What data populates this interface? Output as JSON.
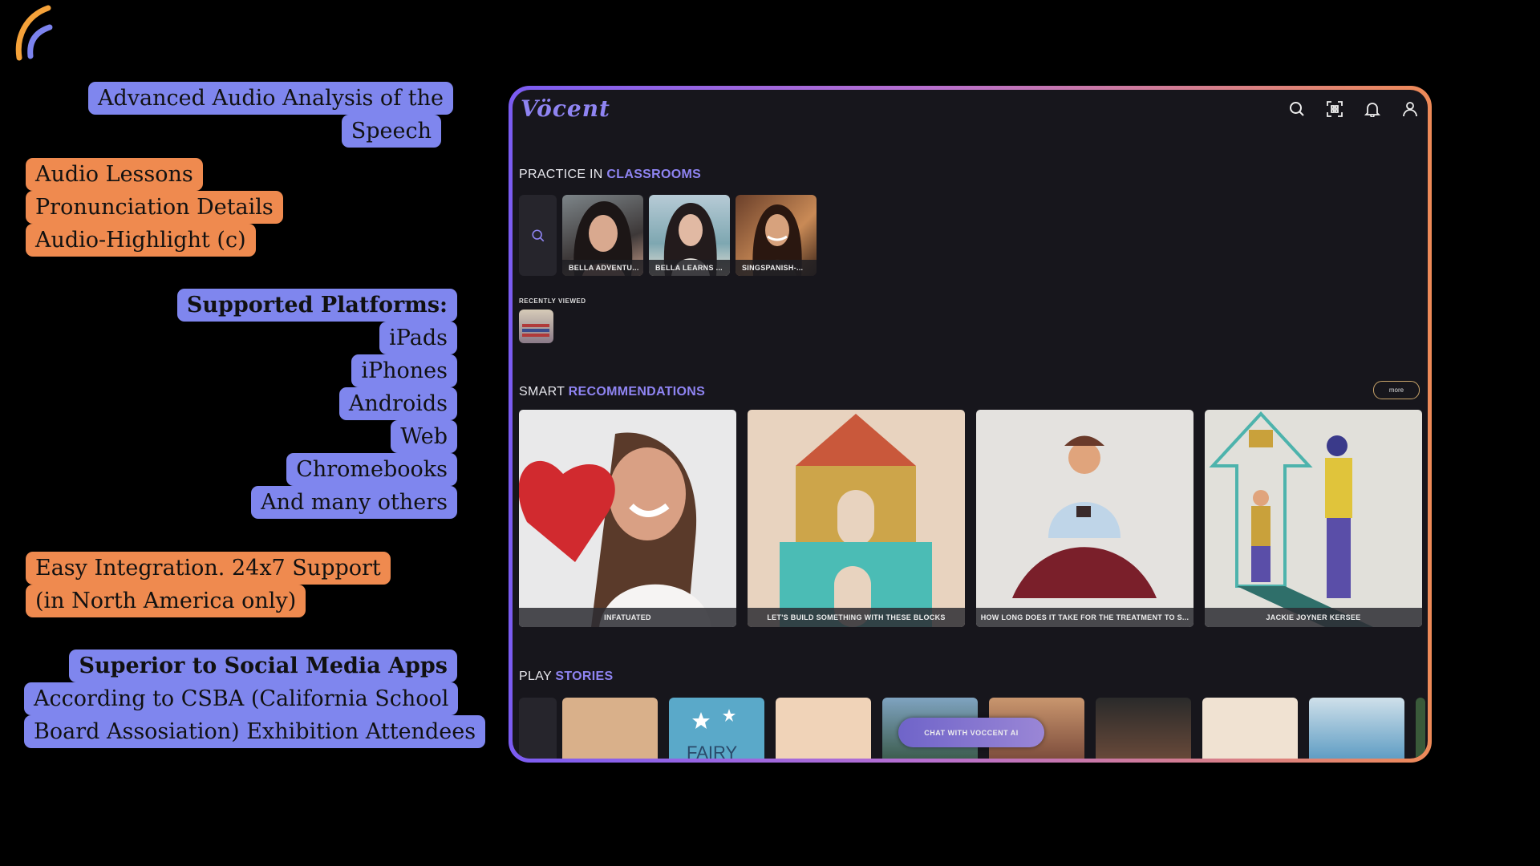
{
  "left_features": {
    "speech": [
      "Advanced Audio Analysis of the",
      "Speech"
    ],
    "audio": [
      "Audio Lessons",
      "Pronunciation Details",
      "Audio-Highlight (c)"
    ],
    "platforms": {
      "heading": "Supported Platforms:",
      "items": [
        "iPads",
        "iPhones",
        "Androids",
        "Web",
        "Chromebooks",
        "And many others"
      ]
    },
    "support": [
      "Easy Integration. 24x7 Support",
      "(in North America only)"
    ],
    "superior": {
      "heading": "Superior to Social Media Apps",
      "lines": [
        "According to CSBA (California School",
        "Board Assosiation) Exhibition Attendees"
      ]
    }
  },
  "app": {
    "brand": "Vöcent",
    "top_icons": [
      "search-icon",
      "qr-scan-icon",
      "bell-icon",
      "user-icon"
    ],
    "practice": {
      "label": "PRACTICE IN",
      "accent": "CLASSROOMS",
      "tiles": [
        "BELLA ADVENTU...",
        "BELLA LEARNS ...",
        "SINGSPANISH-..."
      ]
    },
    "recently_viewed": "RECENTLY VIEWED",
    "smart": {
      "label": "SMART",
      "accent": "RECOMMENDATIONS",
      "more": "more",
      "cards": [
        "INFATUATED",
        "LET'S BUILD SOMETHING WITH THESE BLOCKS",
        "HOW LONG DOES IT TAKE FOR THE TREATMENT TO S...",
        "JACKIE JOYNER KERSEE"
      ]
    },
    "stories": {
      "label": "PLAY",
      "accent": "STORIES",
      "fairy_text": "FAIRY"
    },
    "chat_button": "CHAT WITH VOCCENT AI"
  },
  "colors": {
    "accent": "#8f84f2",
    "blue_box": "#7f86ee",
    "orange_box": "#ef8a4f",
    "frame_start": "#7b5cf2",
    "frame_end": "#ee8a58"
  }
}
